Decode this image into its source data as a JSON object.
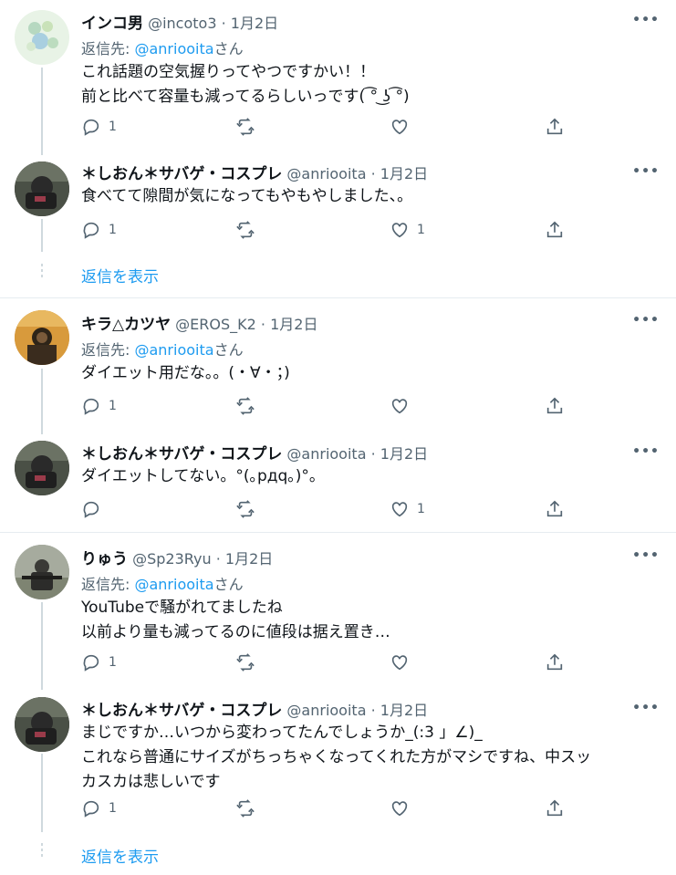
{
  "tweets": [
    {
      "name": "インコ男",
      "handle": "@incoto3",
      "dot": "·",
      "date": "1月2日",
      "reply_prefix": "返信先: ",
      "reply_mention": "@anriooita",
      "reply_suffix": "さん",
      "lines": [
        "これ話題の空気握りってやつですかい！！",
        "前と比べて容量も減ってるらしいっです( ͡° ͜ʖ ͡°)"
      ],
      "counts": {
        "reply": "1",
        "retweet": "",
        "like": ""
      }
    },
    {
      "name": "＊しおん＊サバゲ・コスプレ",
      "handle": "@anriooita",
      "dot": "·",
      "date": "1月2日",
      "lines": [
        "食べてて隙間が気になってもやもやしました、。"
      ],
      "counts": {
        "reply": "1",
        "retweet": "",
        "like": "1"
      }
    },
    {
      "name": "キラ△カツヤ",
      "handle": "@EROS_K2",
      "dot": "·",
      "date": "1月2日",
      "reply_prefix": "返信先: ",
      "reply_mention": "@anriooita",
      "reply_suffix": "さん",
      "lines": [
        "ダイエット用だな。。(・∀・；)"
      ],
      "counts": {
        "reply": "1",
        "retweet": "",
        "like": ""
      }
    },
    {
      "name": "＊しおん＊サバゲ・コスプレ",
      "handle": "@anriooita",
      "dot": "·",
      "date": "1月2日",
      "lines": [
        "ダイエットしてない。°(｡pдq｡)°。"
      ],
      "counts": {
        "reply": "",
        "retweet": "",
        "like": "1"
      }
    },
    {
      "name": "りゅう",
      "handle": "@Sp23Ryu",
      "dot": "·",
      "date": "1月2日",
      "reply_prefix": "返信先: ",
      "reply_mention": "@anriooita",
      "reply_suffix": "さん",
      "lines": [
        "YouTubeで騒がれてましたね",
        "以前より量も減ってるのに値段は据え置き…"
      ],
      "counts": {
        "reply": "1",
        "retweet": "",
        "like": ""
      }
    },
    {
      "name": "＊しおん＊サバゲ・コスプレ",
      "handle": "@anriooita",
      "dot": "·",
      "date": "1月2日",
      "lines": [
        "まじですか…いつから変わってたんでしょうか_(:3 」∠)_",
        "これなら普通にサイズがちっちゃくなってくれた方がマシですね、中スッ",
        "カスカは悲しいです"
      ],
      "counts": {
        "reply": "1",
        "retweet": "",
        "like": ""
      }
    }
  ],
  "show_replies_label": "返信を表示",
  "more_label": "•••",
  "colors": {
    "accent": "#1d9bf0",
    "secondary": "#536471",
    "divider": "#e6ecf0"
  },
  "icons": [
    "reply-icon",
    "retweet-icon",
    "like-icon",
    "share-icon",
    "more-icon"
  ]
}
